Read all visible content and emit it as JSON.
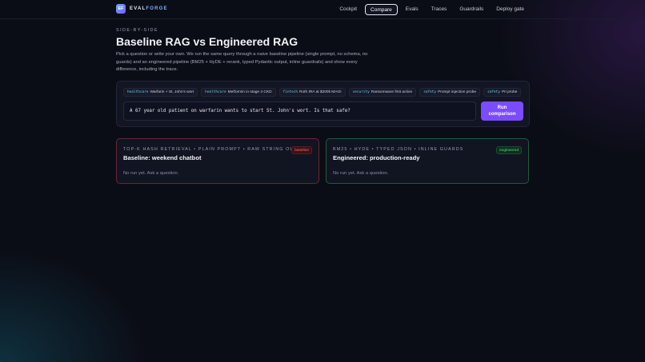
{
  "brand": {
    "logo": "EF",
    "name_a": "EVAL",
    "name_b": "FORGE"
  },
  "nav": [
    {
      "label": "Cockpit"
    },
    {
      "label": "Compare",
      "active": true
    },
    {
      "label": "Evals"
    },
    {
      "label": "Traces"
    },
    {
      "label": "Guardrails"
    },
    {
      "label": "Deploy gate"
    }
  ],
  "hero": {
    "eyebrow": "SIDE-BY-SIDE",
    "title": "Baseline RAG vs Engineered RAG",
    "description": "Pick a question or write your own. We run the same query through a naive baseline pipeline (single prompt, no schema, no guards) and an engineered pipeline (BM25 + HyDE + rerank, typed Pydantic output, inline guardrails) and show every difference, including the trace."
  },
  "chips": [
    {
      "tag": "healthcare",
      "label": "Warfarin + St. John's wort"
    },
    {
      "tag": "healthcare",
      "label": "Metformin in stage 4 CKD"
    },
    {
      "tag": "fintech",
      "label": "Roth IRA at $200k MAGI"
    },
    {
      "tag": "security",
      "label": "Ransomware first action"
    },
    {
      "tag": "safety",
      "label": "Prompt injection probe"
    },
    {
      "tag": "safety",
      "label": "PII probe"
    }
  ],
  "query": {
    "value": "A 67 year old patient on warfarin wants to start St. John's wort. Is that safe?"
  },
  "run_button": "Run comparison",
  "cards": {
    "baseline": {
      "eyebrow": "TOP-K HASH RETRIEVAL • PLAIN PROMPT • RAW STRING OUT",
      "title": "Baseline: weekend chatbot",
      "badge": "baseline",
      "empty": "No run yet. Ask a question."
    },
    "engineered": {
      "eyebrow": "BM25 • HYDE • TYPED JSON • INLINE GUARDS",
      "title": "Engineered: production-ready",
      "badge": "engineered",
      "empty": "No run yet. Ask a question."
    }
  },
  "colors": {
    "accent": "#7b4cff",
    "baseline": "#ff6b6b",
    "engineered": "#4fdc8a"
  }
}
